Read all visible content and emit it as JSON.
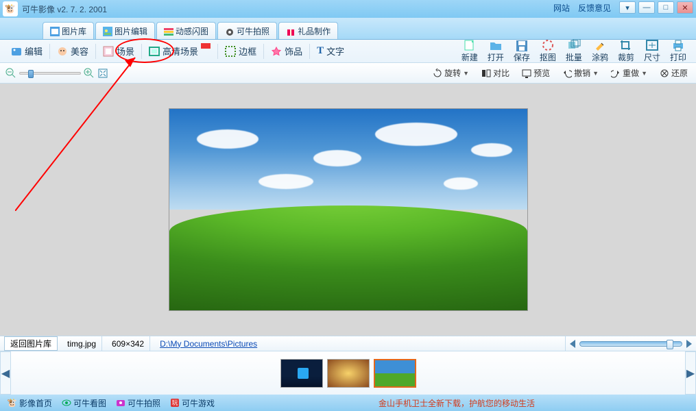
{
  "title": "可牛影像  v2. 7. 2. 2001",
  "topLinks": {
    "site": "网站",
    "feedback": "反馈意见"
  },
  "mainTabs": [
    "图片库",
    "图片编辑",
    "动感闪图",
    "可牛拍照",
    "礼品制作"
  ],
  "secondary": {
    "edit": "编辑",
    "beauty": "美容",
    "scene": "场景",
    "hd": "高清场景",
    "frame": "边框",
    "accessory": "饰品",
    "text": "文字"
  },
  "fileTools": {
    "new": "新建",
    "open": "打开",
    "save": "保存",
    "cutout": "抠图",
    "batch": "批量",
    "doodle": "涂鸦",
    "crop": "裁剪",
    "size": "尺寸",
    "print": "打印"
  },
  "third": {
    "rotate": "旋转",
    "compare": "对比",
    "preview": "预览",
    "undo": "撤销",
    "redo": "重做",
    "restore": "还原"
  },
  "status": {
    "back": "返回图片库",
    "filename": "timg.jpg",
    "dims": "609×342",
    "path": "D:\\My Documents\\Pictures"
  },
  "bottom": {
    "home": "影像首页",
    "view": "可牛看图",
    "camera": "可牛拍照",
    "game": "可牛游戏",
    "promo": "金山手机卫士全新下载，护航您的移动生活"
  }
}
